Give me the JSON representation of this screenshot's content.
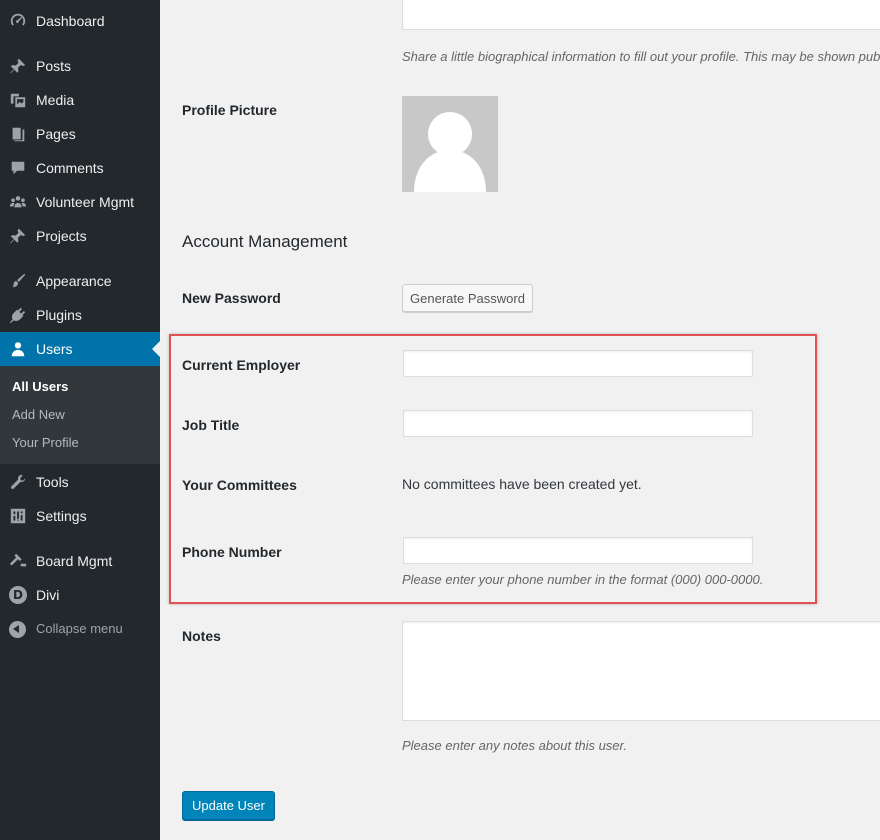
{
  "sidebar": {
    "menu": [
      {
        "label": "Dashboard",
        "icon": "dashboard-icon"
      },
      {
        "label": "Posts",
        "icon": "pin-icon"
      },
      {
        "label": "Media",
        "icon": "media-icon"
      },
      {
        "label": "Pages",
        "icon": "pages-icon"
      },
      {
        "label": "Comments",
        "icon": "comment-icon"
      },
      {
        "label": "Volunteer Mgmt",
        "icon": "groups-icon"
      },
      {
        "label": "Projects",
        "icon": "pin-icon"
      },
      {
        "label": "Appearance",
        "icon": "paintbrush-icon"
      },
      {
        "label": "Plugins",
        "icon": "plugin-icon"
      },
      {
        "label": "Users",
        "icon": "user-icon",
        "active": true
      },
      {
        "label": "Tools",
        "icon": "wrench-icon"
      },
      {
        "label": "Settings",
        "icon": "settings-icon"
      },
      {
        "label": "Board Mgmt",
        "icon": "hammer-icon"
      },
      {
        "label": "Divi",
        "icon": "divi-logo-icon"
      }
    ],
    "submenu": [
      {
        "label": "All Users",
        "current": true
      },
      {
        "label": "Add New"
      },
      {
        "label": "Your Profile"
      }
    ],
    "collapse_label": "Collapse menu",
    "colors": {
      "bg": "#23282d",
      "active": "#0073aa",
      "submenu_bg": "#32373c"
    }
  },
  "main": {
    "bio_description": "Share a little biographical information to fill out your profile. This may be shown publicly.",
    "profile_picture_label": "Profile Picture",
    "account_section_title": "Account Management",
    "new_password_label": "New Password",
    "generate_password_button": "Generate Password",
    "current_employer_label": "Current Employer",
    "current_employer_value": "",
    "job_title_label": "Job Title",
    "job_title_value": "",
    "committees_label": "Your Committees",
    "committees_value": "No committees have been created yet.",
    "phone_label": "Phone Number",
    "phone_value": "",
    "phone_description": "Please enter your phone number in the format (000) 000-0000.",
    "notes_label": "Notes",
    "notes_value": "",
    "notes_description": "Please enter any notes about this user.",
    "update_button": "Update User",
    "colors": {
      "primary_button": "#0085ba",
      "highlight": "#e05252"
    }
  }
}
